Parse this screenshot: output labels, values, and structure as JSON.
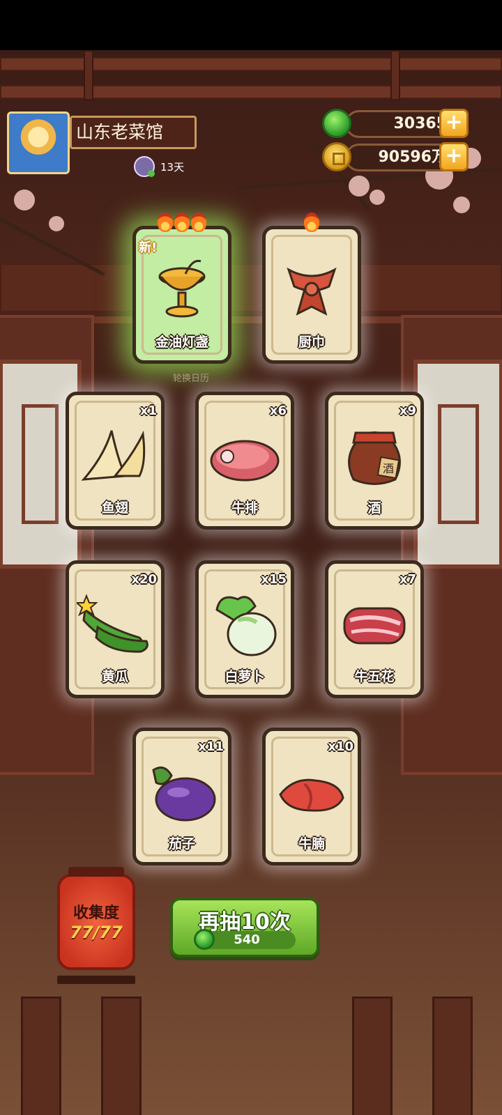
{
  "player": {
    "restaurant_name": "山东老菜馆",
    "days": "13天"
  },
  "currencies": {
    "jade": "30365",
    "gold": "90596万"
  },
  "hint_text": "轮换日历",
  "top_cards": [
    {
      "name": "金油灯盏",
      "flames": 3,
      "is_new": true,
      "new_label": "新!"
    },
    {
      "name": "厨巾",
      "flames": 1,
      "is_new": false
    }
  ],
  "cards": [
    {
      "name": "鱼翅",
      "count": "x1",
      "icon": "shark-fin-icon"
    },
    {
      "name": "牛排",
      "count": "x6",
      "icon": "steak-icon"
    },
    {
      "name": "酒",
      "count": "x9",
      "icon": "wine-jar-icon",
      "jar_text": "酒"
    },
    {
      "name": "黄瓜",
      "count": "x20",
      "icon": "cucumber-icon"
    },
    {
      "name": "白萝卜",
      "count": "x15",
      "icon": "radish-icon"
    },
    {
      "name": "牛五花",
      "count": "x7",
      "icon": "pork-belly-icon"
    },
    {
      "name": "茄子",
      "count": "x11",
      "icon": "eggplant-icon"
    },
    {
      "name": "牛腩",
      "count": "x10",
      "icon": "brisket-icon"
    }
  ],
  "collection": {
    "label": "收集度",
    "progress": "77/77"
  },
  "draw": {
    "label": "再抽10次",
    "cost": "540"
  }
}
